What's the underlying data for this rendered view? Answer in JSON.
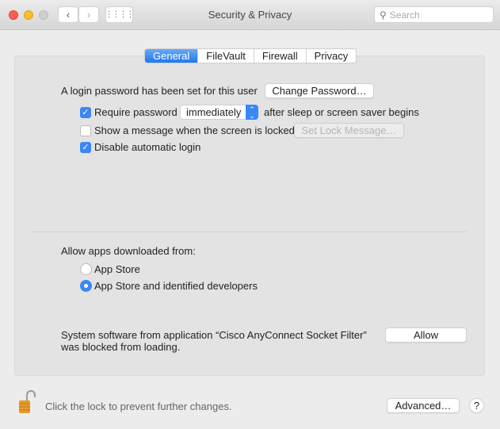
{
  "window": {
    "title": "Security & Privacy",
    "search_placeholder": "Search"
  },
  "tabs": [
    {
      "label": "General",
      "active": true
    },
    {
      "label": "FileVault"
    },
    {
      "label": "Firewall"
    },
    {
      "label": "Privacy"
    }
  ],
  "general": {
    "login_text": "A login password has been set for this user",
    "change_password": "Change Password…",
    "require_password": {
      "label": "Require password",
      "checked": true,
      "select_value": "immediately",
      "suffix": "after sleep or screen saver begins"
    },
    "show_message": {
      "label": "Show a message when the screen is locked",
      "checked": false,
      "button": "Set Lock Message…"
    },
    "disable_auto_login": {
      "label": "Disable automatic login",
      "checked": true
    },
    "allow_apps_label": "Allow apps downloaded from:",
    "radio_options": [
      {
        "label": "App Store",
        "selected": false
      },
      {
        "label": "App Store and identified developers",
        "selected": true
      }
    ],
    "blocked_line1": "System software from application “Cisco AnyConnect Socket Filter”",
    "blocked_line2": "was blocked from loading.",
    "allow_button": "Allow"
  },
  "footer": {
    "lock_text": "Click the lock to prevent further changes.",
    "advanced": "Advanced…",
    "help": "?"
  }
}
